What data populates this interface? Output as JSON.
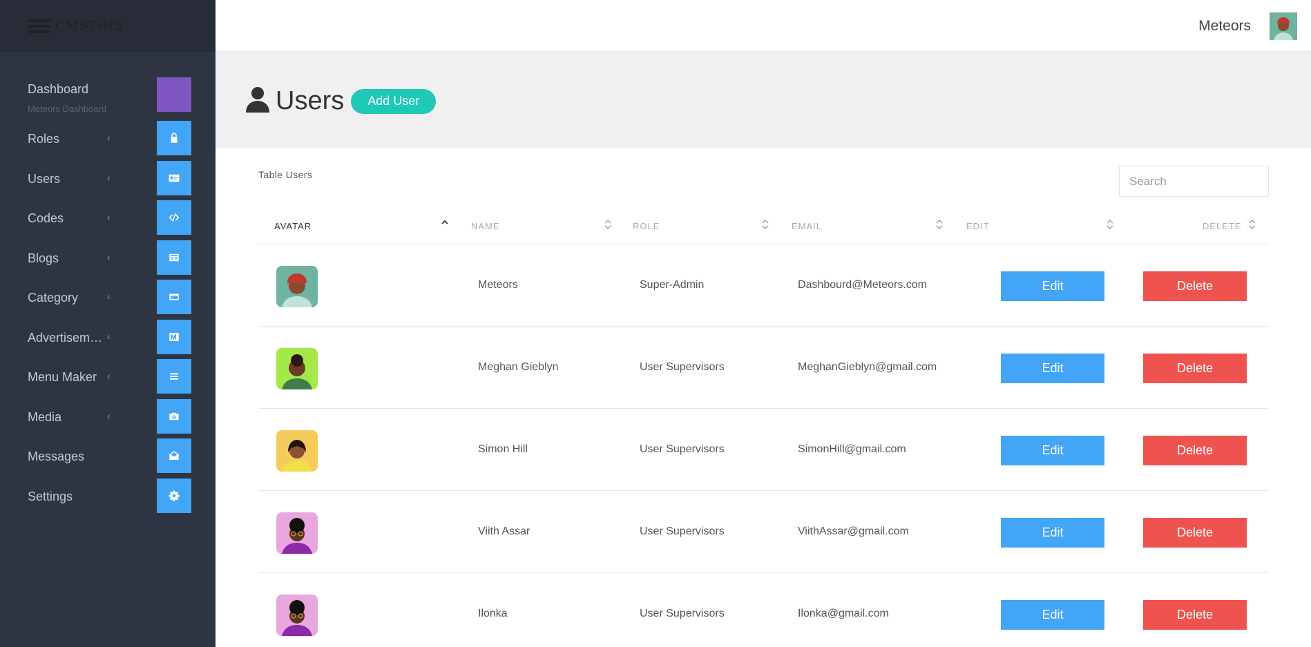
{
  "sidebar": {
    "logo_text": "CMSTHIS",
    "items": [
      {
        "label": "Dashboard",
        "sub": "Meteors Dashboard",
        "icon": "dashboard-icon",
        "has_chevron": false
      },
      {
        "label": "Roles",
        "icon": "lock-icon",
        "has_chevron": true
      },
      {
        "label": "Users",
        "icon": "id-card-icon",
        "has_chevron": true
      },
      {
        "label": "Codes",
        "icon": "code-icon",
        "has_chevron": true
      },
      {
        "label": "Blogs",
        "icon": "newspaper-icon",
        "has_chevron": true
      },
      {
        "label": "Category",
        "icon": "card-icon",
        "has_chevron": true
      },
      {
        "label": "Advertisements",
        "icon": "medium-icon",
        "has_chevron": true
      },
      {
        "label": "Menu Maker",
        "icon": "menu-icon",
        "has_chevron": true
      },
      {
        "label": "Media",
        "icon": "camera-icon",
        "has_chevron": true
      },
      {
        "label": "Messages",
        "icon": "envelope-icon",
        "has_chevron": false
      },
      {
        "label": "Settings",
        "icon": "gear-icon",
        "has_chevron": false
      }
    ]
  },
  "topbar": {
    "user_name": "Meteors"
  },
  "header": {
    "title": "Users",
    "add_button": "Add User"
  },
  "table": {
    "label": "Table Users",
    "search_placeholder": "Search",
    "columns": [
      "Avatar",
      "Name",
      "Role",
      "Email",
      "Edit",
      "Delete"
    ],
    "rows": [
      {
        "name": "Meteors",
        "role": "Super-Admin",
        "email": "Dashbourd@Meteors.com",
        "avatar_bg": "#6fb3a0",
        "edit": "Edit",
        "delete": "Delete"
      },
      {
        "name": "Meghan Gieblyn",
        "role": "User Supervisors",
        "email": "MeghanGieblyn@gmail.com",
        "avatar_bg": "#a4e84a",
        "edit": "Edit",
        "delete": "Delete"
      },
      {
        "name": "Simon Hill",
        "role": "User Supervisors",
        "email": "SimonHill@gmail.com",
        "avatar_bg": "#f5cb5c",
        "edit": "Edit",
        "delete": "Delete"
      },
      {
        "name": "Viith Assar",
        "role": "User Supervisors",
        "email": "ViithAssar@gmail.com",
        "avatar_bg": "#e9a7e0",
        "edit": "Edit",
        "delete": "Delete"
      },
      {
        "name": "Ilonka",
        "role": "User Supervisors",
        "email": "Ilonka@gmail.com",
        "avatar_bg": "#e9a7e0",
        "edit": "Edit",
        "delete": "Delete"
      }
    ]
  },
  "colors": {
    "sidebar_bg": "#2e3442",
    "tile_blue": "#42a5f5",
    "dashboard_tile": "#7e57c2",
    "add_button": "#1ec9b7",
    "edit_button": "#42a5f5",
    "delete_button": "#ef5350"
  }
}
